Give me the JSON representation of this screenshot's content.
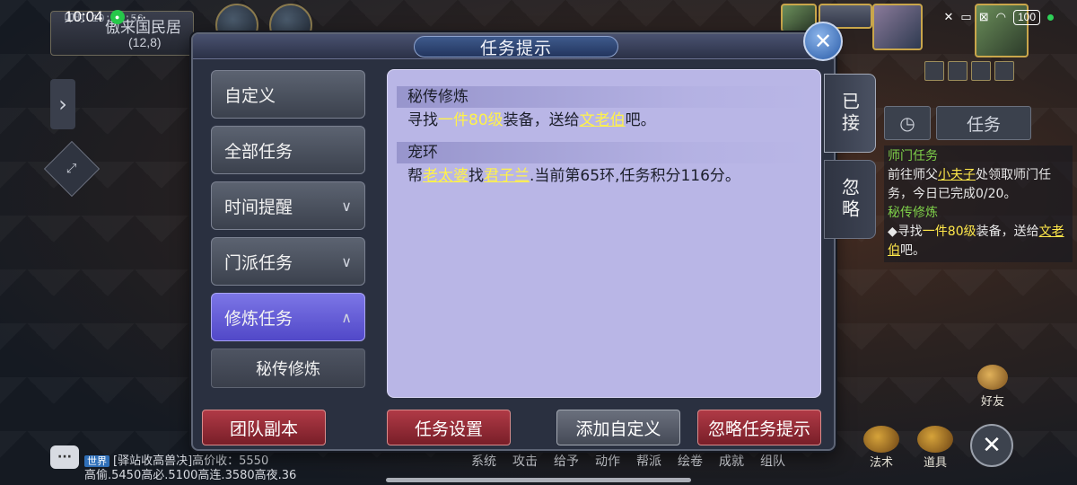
{
  "status_bar": {
    "time": "10:04",
    "battery": "100"
  },
  "hud": {
    "location_name": "傲来国民居",
    "location_coord": "(12,8)",
    "game_time": "卯时 10:04:56"
  },
  "tracker": {
    "tab_label": "任务",
    "entries": [
      {
        "title": "师门任务",
        "text_a": "前往师父",
        "link": "小夫子",
        "text_b": "处领取师门任务，今日已完成0/20。"
      },
      {
        "title": "秘传修炼",
        "text_a": "◆寻找",
        "item": "一件80级",
        "text_b": "装备，送给",
        "link": "文老伯",
        "text_c": "吧。"
      }
    ]
  },
  "dialog": {
    "title": "任务提示",
    "categories": [
      {
        "label": "自定义",
        "chevron": ""
      },
      {
        "label": "全部任务",
        "chevron": ""
      },
      {
        "label": "时间提醒",
        "chevron": "∨"
      },
      {
        "label": "门派任务",
        "chevron": "∨"
      },
      {
        "label": "修炼任务",
        "chevron": "∧"
      }
    ],
    "sub_category": "秘传修炼",
    "quests": [
      {
        "title": "秘传修炼",
        "parts": [
          "寻找",
          "一件80级",
          "装备，送给",
          "文老伯",
          "吧。"
        ]
      },
      {
        "title": "宠环",
        "parts": [
          "帮",
          "老太婆",
          "找",
          "君子兰",
          ".当前第65环,任务积分116分。"
        ]
      }
    ],
    "side_tabs": [
      "已接",
      "忽略"
    ],
    "buttons": {
      "team_dungeon": "团队副本",
      "quest_settings": "任务设置",
      "add_custom": "添加自定义",
      "ignore_hint": "忽略任务提示"
    }
  },
  "chat": {
    "channel": "世界",
    "line1": "[驿站收高兽决]高价收：5550",
    "line2": "高偷.5450高必.5100高连.3580高夜.36"
  },
  "bottom_menu": [
    "系统",
    "攻击",
    "给予",
    "动作",
    "帮派",
    "绘卷",
    "成就",
    "组队"
  ],
  "bottom_icons": [
    "法术",
    "道具"
  ],
  "friends_label": "好友"
}
